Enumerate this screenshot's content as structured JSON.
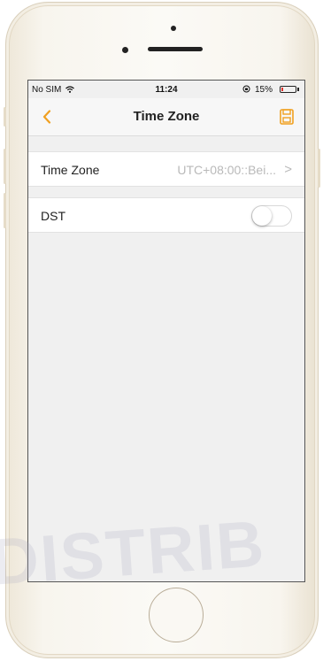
{
  "status_bar": {
    "carrier": "No SIM",
    "wifi_icon": "wifi-icon",
    "time": "11:24",
    "battery_percent": "15%",
    "battery_level": 0.15,
    "battery_color": "#e0312b"
  },
  "nav": {
    "back_icon": "chevron-left-icon",
    "title": "Time Zone",
    "save_icon": "save-icon",
    "accent_color": "#f0a020"
  },
  "rows": {
    "time_zone": {
      "label": "Time Zone",
      "value": "UTC+08:00::Bei...",
      "chevron": ">"
    },
    "dst": {
      "label": "DST",
      "enabled": false
    }
  },
  "watermark": "DISTRIB"
}
